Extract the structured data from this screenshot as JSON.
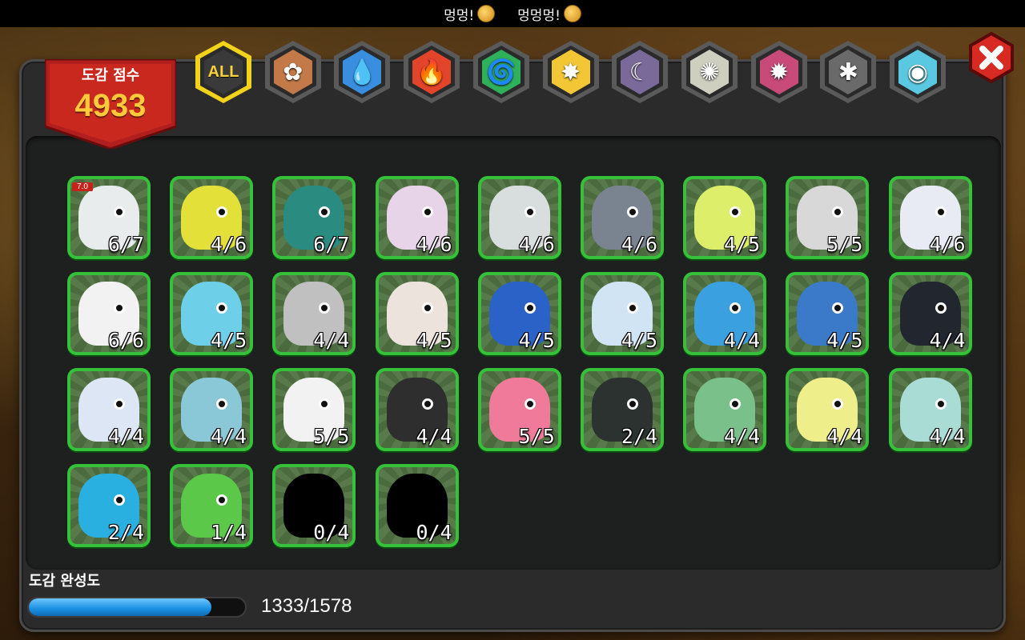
{
  "status_bar": {
    "messages": [
      {
        "text": "멍멍!",
        "emoji_icon": "smile-emoji-icon"
      },
      {
        "text": "멍멍멍!",
        "emoji_icon": "laugh-emoji-icon"
      }
    ]
  },
  "score": {
    "title": "도감 점수",
    "value": "4933"
  },
  "tabs": [
    {
      "name": "tab-all",
      "label": "ALL",
      "icon": "all-icon",
      "color": "#3a3a3a",
      "selected": true
    },
    {
      "name": "tab-earth",
      "label": "",
      "icon": "earth-element-icon",
      "color": "#c47a48"
    },
    {
      "name": "tab-water",
      "label": "",
      "icon": "water-element-icon",
      "color": "#3a8ee0"
    },
    {
      "name": "tab-fire",
      "label": "",
      "icon": "fire-element-icon",
      "color": "#e2452a"
    },
    {
      "name": "tab-wind",
      "label": "",
      "icon": "wind-element-icon",
      "color": "#2fb05a"
    },
    {
      "name": "tab-light",
      "label": "",
      "icon": "light-element-icon",
      "color": "#f2c634"
    },
    {
      "name": "tab-dark",
      "label": "",
      "icon": "dark-element-icon",
      "color": "#7a6a9a"
    },
    {
      "name": "tab-holy",
      "label": "",
      "icon": "holy-element-icon",
      "color": "#cfcfc0"
    },
    {
      "name": "tab-chaos",
      "label": "",
      "icon": "chaos-element-icon",
      "color": "#c84a78"
    },
    {
      "name": "tab-void",
      "label": "",
      "icon": "void-element-icon",
      "color": "#6a6a6a"
    },
    {
      "name": "tab-rainbow",
      "label": "",
      "icon": "rainbow-element-icon",
      "color": "#5ac8e0"
    }
  ],
  "close_button": {
    "icon": "close-icon"
  },
  "dragons": [
    {
      "count": "6/7",
      "color": "#e8ecec",
      "badge": "7.0"
    },
    {
      "count": "4/6",
      "color": "#e4e03a"
    },
    {
      "count": "6/7",
      "color": "#2a8c80"
    },
    {
      "count": "4/6",
      "color": "#e8d4e8"
    },
    {
      "count": "4/6",
      "color": "#d8dede"
    },
    {
      "count": "4/6",
      "color": "#7a8490"
    },
    {
      "count": "4/5",
      "color": "#dcee6a"
    },
    {
      "count": "5/5",
      "color": "#d8d8d8"
    },
    {
      "count": "4/6",
      "color": "#e8eaf4"
    },
    {
      "count": "6/6",
      "color": "#f2f2f2"
    },
    {
      "count": "4/5",
      "color": "#6ed0e8"
    },
    {
      "count": "4/4",
      "color": "#c0c0c0"
    },
    {
      "count": "4/5",
      "color": "#ece4dc"
    },
    {
      "count": "4/5",
      "color": "#2a62c8"
    },
    {
      "count": "4/5",
      "color": "#d0e4f4"
    },
    {
      "count": "4/4",
      "color": "#3aa0e0"
    },
    {
      "count": "4/5",
      "color": "#3a7ac8"
    },
    {
      "count": "4/4",
      "color": "#22262e"
    },
    {
      "count": "4/4",
      "color": "#dde6f4"
    },
    {
      "count": "4/4",
      "color": "#8ac8d8"
    },
    {
      "count": "5/5",
      "color": "#f2f2f2"
    },
    {
      "count": "4/4",
      "color": "#2e2e2e"
    },
    {
      "count": "5/5",
      "color": "#f07a9a"
    },
    {
      "count": "2/4",
      "color": "#2c3230"
    },
    {
      "count": "4/4",
      "color": "#7ac08a"
    },
    {
      "count": "4/4",
      "color": "#eeee8a"
    },
    {
      "count": "4/4",
      "color": "#a8dcd4"
    },
    {
      "count": "2/4",
      "color": "#2ab0e0"
    },
    {
      "count": "1/4",
      "color": "#5cc84a"
    },
    {
      "count": "0/4",
      "color": "#000000",
      "silhouette": true
    },
    {
      "count": "0/4",
      "color": "#000000",
      "silhouette": true
    }
  ],
  "completion": {
    "label": "도감 완성도",
    "current": 1333,
    "total": 1578,
    "text": "1333/1578",
    "fraction": 0.845
  }
}
